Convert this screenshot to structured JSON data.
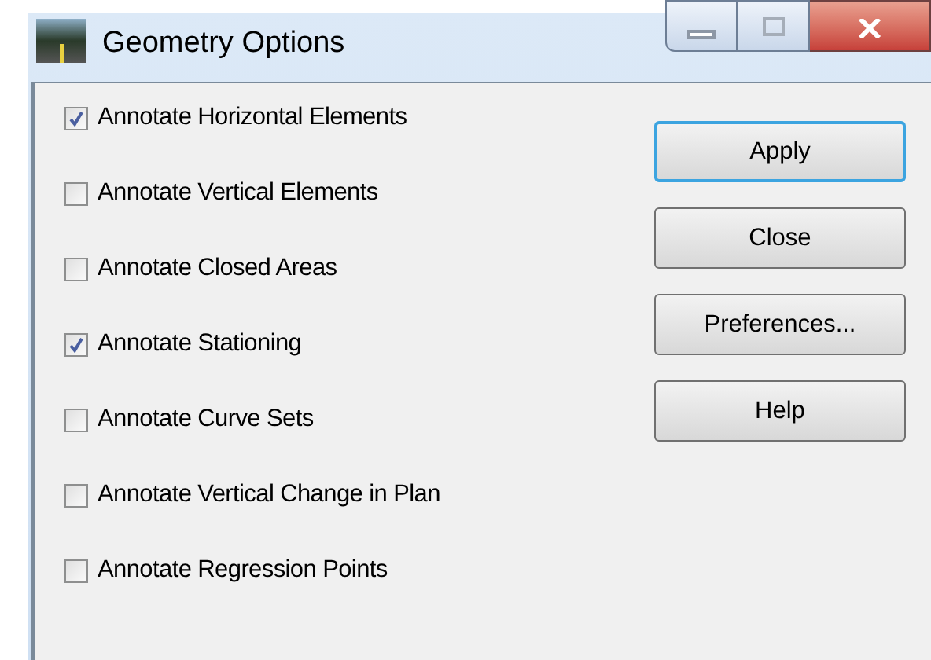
{
  "window": {
    "title": "Geometry Options"
  },
  "options": [
    {
      "label": "Annotate Horizontal Elements",
      "checked": true
    },
    {
      "label": "Annotate Vertical Elements",
      "checked": false
    },
    {
      "label": "Annotate Closed Areas",
      "checked": false
    },
    {
      "label": "Annotate Stationing",
      "checked": true
    },
    {
      "label": "Annotate Curve Sets",
      "checked": false
    },
    {
      "label": "Annotate Vertical Change in Plan",
      "checked": false
    },
    {
      "label": "Annotate Regression Points",
      "checked": false
    }
  ],
  "buttons": [
    {
      "label": "Apply",
      "default": true
    },
    {
      "label": "Close",
      "default": false
    },
    {
      "label": "Preferences...",
      "default": false
    },
    {
      "label": "Help",
      "default": false
    }
  ]
}
